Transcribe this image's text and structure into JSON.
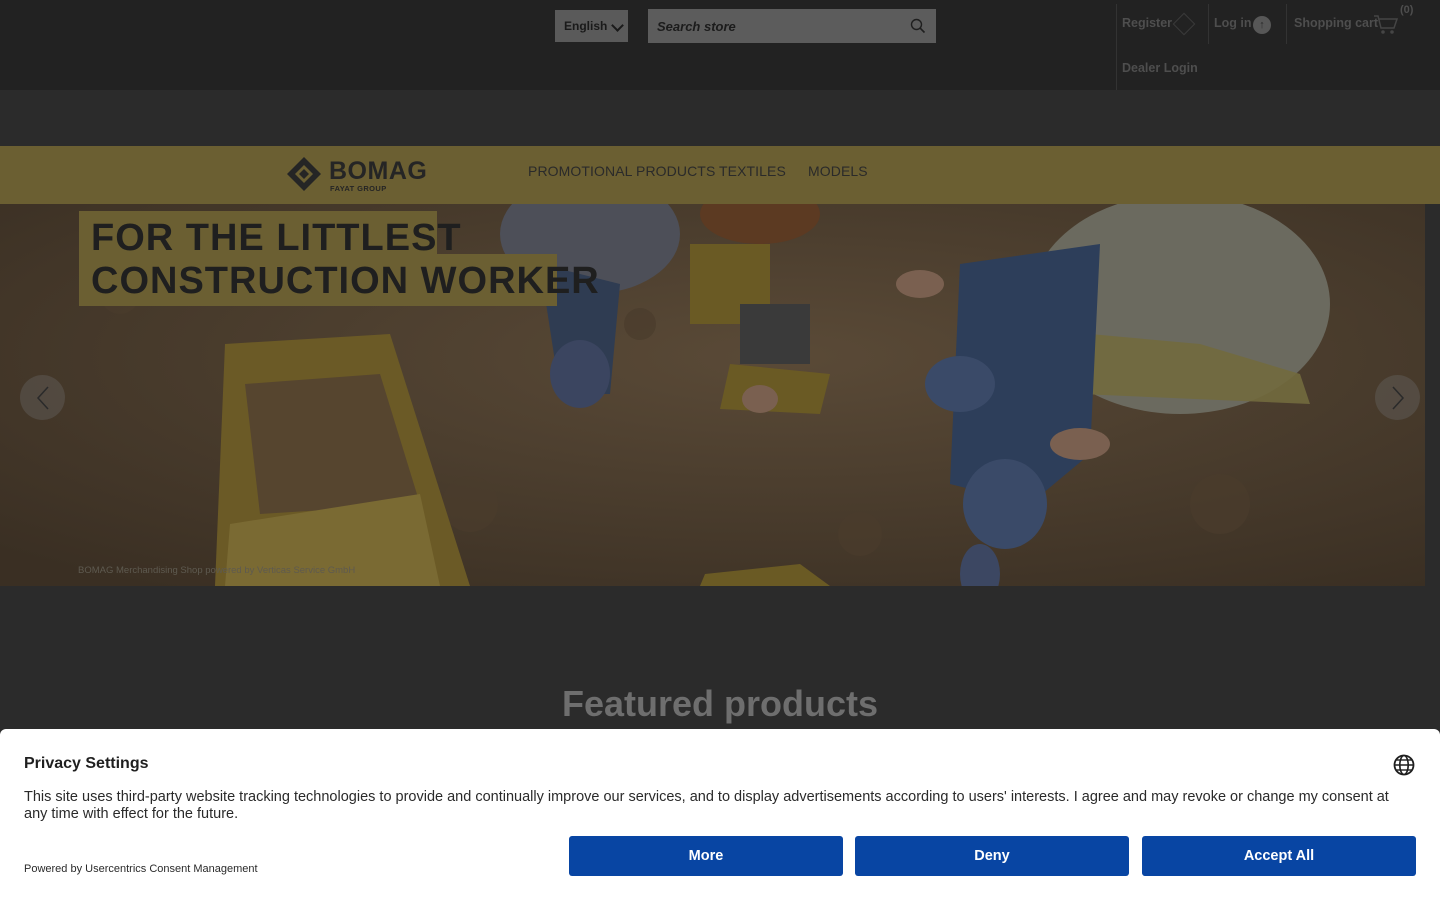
{
  "header": {
    "language_selected": "English",
    "search_placeholder": "Search store",
    "register_label": "Register",
    "login_label": "Log in",
    "dealer_login_label": "Dealer Login",
    "cart_label": "Shopping cart",
    "cart_count": "(0)"
  },
  "brand": {
    "logo_word": "BOMAG",
    "logo_sub": "FAYAT GROUP"
  },
  "nav": {
    "items": [
      {
        "label": "PROMOTIONAL PRODUCTS"
      },
      {
        "label": "TEXTILES"
      },
      {
        "label": "MODELS"
      }
    ]
  },
  "hero": {
    "headline_line1": "FOR THE LITTLEST",
    "headline_line2": "CONSTRUCTION WORKER",
    "caption": "BOMAG Merchandising Shop powered by Verticas Service GmbH"
  },
  "featured": {
    "title": "Featured products"
  },
  "consent": {
    "title": "Privacy Settings",
    "text": "This site uses third-party website tracking technologies to provide and continually improve our services, and to display advertisements according to users' interests. I agree and may revoke or change my consent at any time with effect for the future.",
    "powered_by": "Powered by Usercentrics Consent Management",
    "more_label": "More",
    "deny_label": "Deny",
    "accept_label": "Accept All"
  },
  "colors": {
    "brand_yellow_dimmed": "#6b5f32",
    "consent_button": "#0845a3",
    "page_overlay": "#2b2b2b"
  }
}
